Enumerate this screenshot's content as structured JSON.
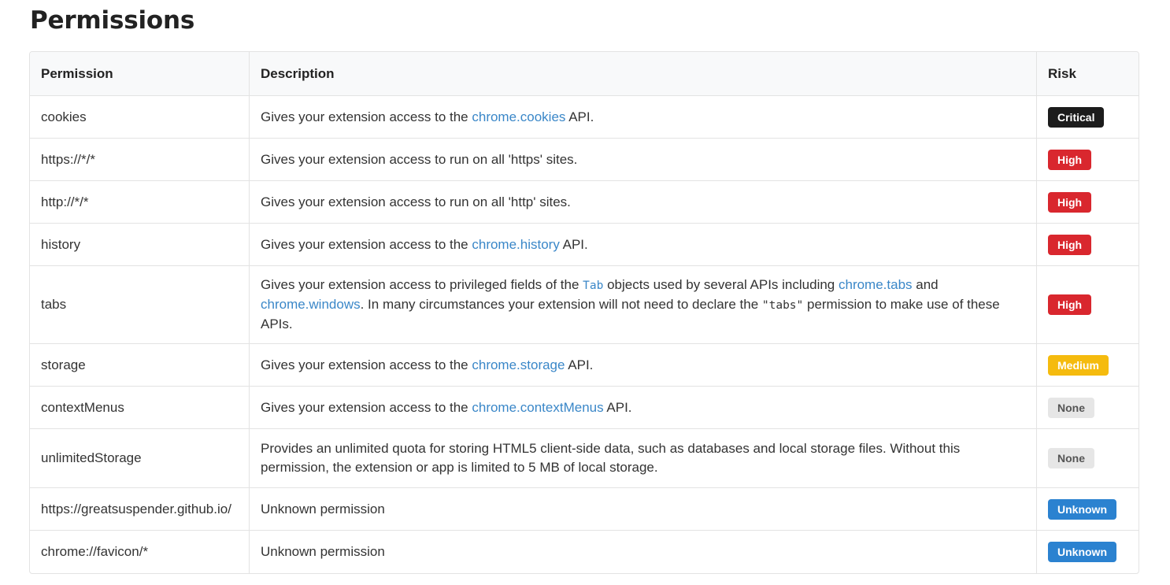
{
  "page": {
    "title": "Permissions"
  },
  "table": {
    "headers": {
      "permission": "Permission",
      "description": "Description",
      "risk": "Risk"
    },
    "risk_colors": {
      "Critical": {
        "bg": "#1c1c1c",
        "fg": "#ffffff"
      },
      "High": {
        "bg": "#d9272e",
        "fg": "#ffffff"
      },
      "Medium": {
        "bg": "#f5bb0e",
        "fg": "#ffffff"
      },
      "None": {
        "bg": "#e6e6e6",
        "fg": "#555555"
      },
      "Unknown": {
        "bg": "#2b82d0",
        "fg": "#ffffff"
      }
    },
    "rows": [
      {
        "permission": "cookies",
        "description": [
          {
            "text": "Gives your extension access to the "
          },
          {
            "text": "chrome.cookies",
            "link": true
          },
          {
            "text": " API."
          }
        ],
        "risk": "Critical"
      },
      {
        "permission": "https://*/*",
        "description": [
          {
            "text": "Gives your extension access to run on all 'https' sites."
          }
        ],
        "risk": "High"
      },
      {
        "permission": "http://*/*",
        "description": [
          {
            "text": "Gives your extension access to run on all 'http' sites."
          }
        ],
        "risk": "High"
      },
      {
        "permission": "history",
        "description": [
          {
            "text": "Gives your extension access to the "
          },
          {
            "text": "chrome.history",
            "link": true
          },
          {
            "text": " API."
          }
        ],
        "risk": "High"
      },
      {
        "permission": "tabs",
        "description": [
          {
            "text": "Gives your extension access to privileged fields of the "
          },
          {
            "text": "Tab",
            "code": true,
            "link": true
          },
          {
            "text": " objects used by several APIs including "
          },
          {
            "text": "chrome.tabs",
            "link": true
          },
          {
            "text": " and "
          },
          {
            "text": "chrome.windows",
            "link": true
          },
          {
            "text": ". In many circumstances your extension will not need to declare the "
          },
          {
            "text": "\"tabs\"",
            "code": true
          },
          {
            "text": " permission to make use of these APIs."
          }
        ],
        "risk": "High"
      },
      {
        "permission": "storage",
        "description": [
          {
            "text": "Gives your extension access to the "
          },
          {
            "text": "chrome.storage",
            "link": true
          },
          {
            "text": " API."
          }
        ],
        "risk": "Medium"
      },
      {
        "permission": "contextMenus",
        "description": [
          {
            "text": "Gives your extension access to the "
          },
          {
            "text": "chrome.contextMenus",
            "link": true
          },
          {
            "text": " API."
          }
        ],
        "risk": "None"
      },
      {
        "permission": "unlimitedStorage",
        "description": [
          {
            "text": "Provides an unlimited quota for storing HTML5 client-side data, such as databases and local storage files. Without this permission, the extension or app is limited to 5 MB of local storage."
          }
        ],
        "risk": "None"
      },
      {
        "permission": "https://greatsuspender.github.io/",
        "description": [
          {
            "text": "Unknown permission"
          }
        ],
        "risk": "Unknown"
      },
      {
        "permission": "chrome://favicon/*",
        "description": [
          {
            "text": "Unknown permission"
          }
        ],
        "risk": "Unknown"
      }
    ]
  }
}
